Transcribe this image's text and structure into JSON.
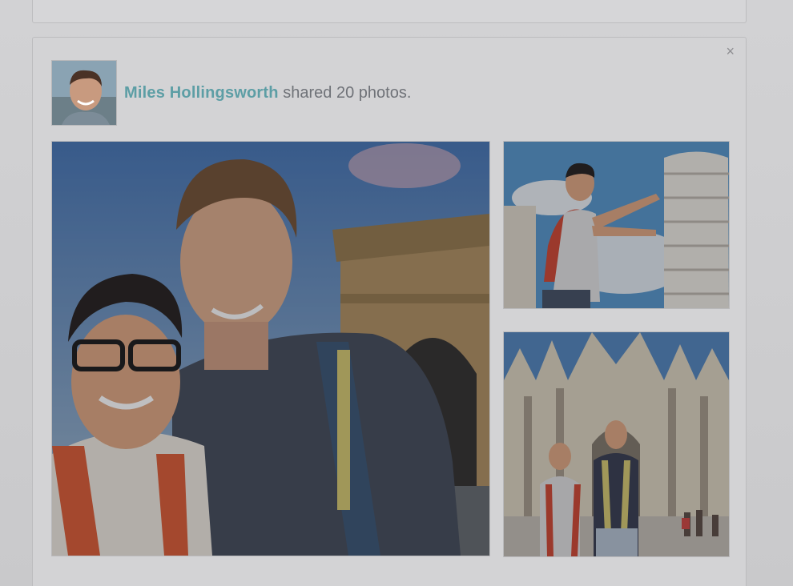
{
  "feed_item": {
    "author": "Miles Hollingsworth",
    "action_text": "shared 20 photos.",
    "close_symbol": "×",
    "avatar_icon": "user-avatar",
    "photos": [
      {
        "alt": "selfie-arc-de-triomphe"
      },
      {
        "alt": "leaning-tower-of-pisa"
      },
      {
        "alt": "milan-cathedral"
      }
    ]
  },
  "colors": {
    "author_link": "#5d9ea5",
    "text": "#6f7278",
    "card_bg": "#d3d3d5"
  }
}
